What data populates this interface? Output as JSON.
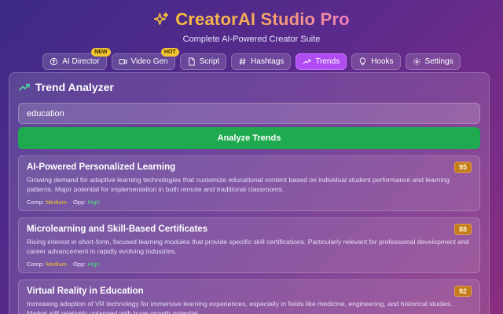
{
  "app": {
    "title": "CreatorAI Studio Pro",
    "subtitle": "Complete AI-Powered Creator Suite",
    "accent": "#b04cf2"
  },
  "nav": {
    "tabs": [
      {
        "label": "AI Director",
        "icon": "brain-icon",
        "badge": "NEW"
      },
      {
        "label": "Video Gen",
        "icon": "video-camera-icon",
        "badge": "HOT"
      },
      {
        "label": "Script",
        "icon": "document-icon"
      },
      {
        "label": "Hashtags",
        "icon": "hash-icon"
      },
      {
        "label": "Trends",
        "icon": "trending-up-icon",
        "active": true
      },
      {
        "label": "Hooks",
        "icon": "lightbulb-icon"
      },
      {
        "label": "Settings",
        "icon": "gear-icon"
      }
    ]
  },
  "panel": {
    "title": "Trend Analyzer",
    "search_value": "education",
    "analyze_label": "Analyze Trends"
  },
  "trends": [
    {
      "title": "AI-Powered Personalized Learning",
      "score": "95",
      "description": "Growing demand for adaptive learning technologies that customize educational content based on individual student performance and learning patterns. Major potential for implementation in both remote and traditional classrooms.",
      "comp_label": "Comp:",
      "comp_value": "Medium",
      "opp_label": "Opp:",
      "opp_value": "High"
    },
    {
      "title": "Microlearning and Skill-Based Certificates",
      "score": "88",
      "description": "Rising interest in short-form, focused learning modules that provide specific skill certifications. Particularly relevant for professional development and career advancement in rapidly evolving industries.",
      "comp_label": "Comp:",
      "comp_value": "Medium",
      "opp_label": "Opp:",
      "opp_value": "High"
    },
    {
      "title": "Virtual Reality in Education",
      "score": "92",
      "description": "Increasing adoption of VR technology for immersive learning experiences, especially in fields like medicine, engineering, and historical studies. Market still relatively untapped with huge growth potential."
    }
  ]
}
